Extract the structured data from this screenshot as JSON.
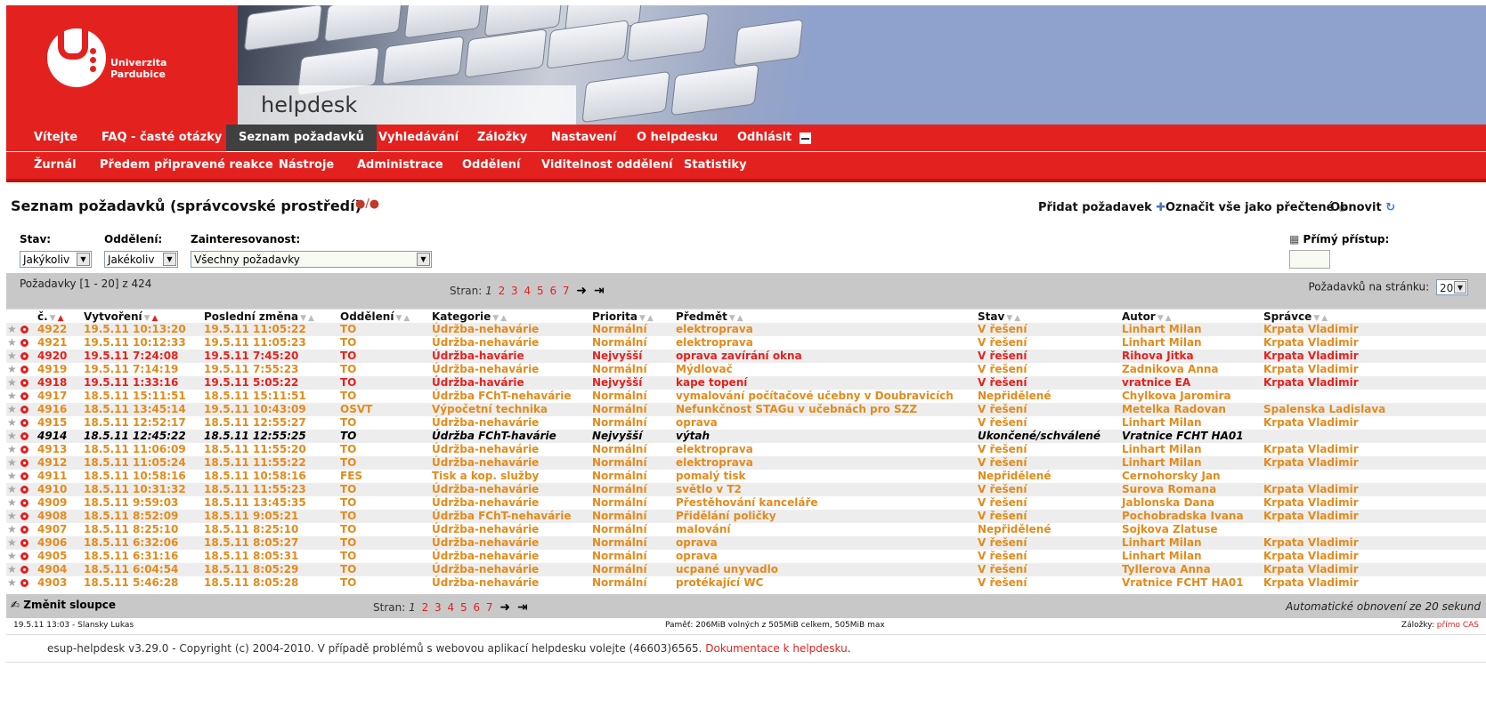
{
  "header": {
    "logo_text_1": "Univerzita",
    "logo_text_2": "Pardubice",
    "app_title": "helpdesk"
  },
  "nav_primary": [
    {
      "label": "Vítejte",
      "active": false
    },
    {
      "label": "FAQ - časté otázky",
      "active": false
    },
    {
      "label": "Seznam požadavků",
      "active": true
    },
    {
      "label": "Vyhledávání",
      "active": false
    },
    {
      "label": "Záložky",
      "active": false
    },
    {
      "label": "Nastavení",
      "active": false
    },
    {
      "label": "O helpdesku",
      "active": false
    },
    {
      "label": "Odhlásit",
      "active": false
    }
  ],
  "nav_secondary": [
    {
      "label": "Žurnál"
    },
    {
      "label": "Předem připravené reakce"
    },
    {
      "label": "Nástroje"
    },
    {
      "label": "Administrace"
    },
    {
      "label": "Oddělení"
    },
    {
      "label": "Viditelnost oddělení"
    },
    {
      "label": "Statistiky"
    }
  ],
  "page": {
    "title": "Seznam požadavků (správcovské prostředí)",
    "add_label": "Přidat požadavek",
    "mark_read_label": "Označit vše jako přečtené",
    "refresh_label": "Obnovit"
  },
  "filters": {
    "state_label": "Stav:",
    "state_value": "Jakýkoliv",
    "dept_label": "Oddělení:",
    "dept_value": "Jakékoliv",
    "interest_label": "Zainteresovanost:",
    "interest_value": "Všechny požadavky",
    "direct_label": "Přímý přístup:",
    "direct_value": ""
  },
  "paging": {
    "summary": "Požadavky [1 - 20] z 424",
    "label": "Stran:",
    "current": "1",
    "pages": [
      "2",
      "3",
      "4",
      "5",
      "6",
      "7"
    ],
    "per_page_label": "Požadavků na stránku:",
    "per_page_value": "20"
  },
  "columns": [
    "č.",
    "Vytvoření",
    "Poslední změna",
    "Oddělení",
    "Kategorie",
    "Priorita",
    "Předmět",
    "Stav",
    "Autor",
    "Správce"
  ],
  "tickets": [
    {
      "id": "4922",
      "created": "19.5.11 10:13:20",
      "changed": "19.5.11 11:05:22",
      "dept": "TO",
      "category": "Údržba-nehavárie",
      "priority": "Normální",
      "subject": "elektroprava",
      "status": "V řešení",
      "author": "Linhart Milan",
      "manager": "Krpata Vladimir",
      "tone": "orange"
    },
    {
      "id": "4921",
      "created": "19.5.11 10:12:33",
      "changed": "19.5.11 11:05:23",
      "dept": "TO",
      "category": "Údržba-nehavárie",
      "priority": "Normální",
      "subject": "elektroprava",
      "status": "V řešení",
      "author": "Linhart Milan",
      "manager": "Krpata Vladimir",
      "tone": "orange"
    },
    {
      "id": "4920",
      "created": "19.5.11 7:24:08",
      "changed": "19.5.11 7:45:20",
      "dept": "TO",
      "category": "Údržba-havárie",
      "priority": "Nejvyšší",
      "subject": "oprava zavírání okna",
      "status": "V řešení",
      "author": "Rihova Jitka",
      "manager": "Krpata Vladimir",
      "tone": "red"
    },
    {
      "id": "4919",
      "created": "19.5.11 7:14:19",
      "changed": "19.5.11 7:55:23",
      "dept": "TO",
      "category": "Údržba-nehavárie",
      "priority": "Normální",
      "subject": "Mýdlovač",
      "status": "V řešení",
      "author": "Zadnikova Anna",
      "manager": "Krpata Vladimir",
      "tone": "orange"
    },
    {
      "id": "4918",
      "created": "19.5.11 1:33:16",
      "changed": "19.5.11 5:05:22",
      "dept": "TO",
      "category": "Údržba-havárie",
      "priority": "Nejvyšší",
      "subject": "kape topení",
      "status": "V řešení",
      "author": "vratnice EA",
      "manager": "Krpata Vladimir",
      "tone": "red"
    },
    {
      "id": "4917",
      "created": "18.5.11 15:11:51",
      "changed": "18.5.11 15:11:51",
      "dept": "TO",
      "category": "Údržba FChT-nehavárie",
      "priority": "Normální",
      "subject": "vymalování počítačové učebny v Doubravicích",
      "status": "Nepřidělené",
      "author": "Chylkova Jaromira",
      "manager": "",
      "tone": "orange"
    },
    {
      "id": "4916",
      "created": "18.5.11 13:45:14",
      "changed": "19.5.11 10:43:09",
      "dept": "OSVT",
      "category": "Výpočetní technika",
      "priority": "Normální",
      "subject": "Nefunkčnost STAGu v učebnách pro SZZ",
      "status": "V řešení",
      "author": "Metelka Radovan",
      "manager": "Spalenska Ladislava",
      "tone": "orange"
    },
    {
      "id": "4915",
      "created": "18.5.11 12:52:17",
      "changed": "18.5.11 12:55:27",
      "dept": "TO",
      "category": "Údržba-nehavárie",
      "priority": "Normální",
      "subject": "oprava",
      "status": "V řešení",
      "author": "Linhart Milan",
      "manager": "Krpata Vladimir",
      "tone": "orange"
    },
    {
      "id": "4914",
      "created": "18.5.11 12:45:22",
      "changed": "18.5.11 12:55:25",
      "dept": "TO",
      "category": "Údržba FChT-havárie",
      "priority": "Nejvyšší",
      "subject": "výtah",
      "status": "Ukončené/schválené",
      "author": "Vratnice FCHT HA01",
      "manager": "",
      "tone": "black"
    },
    {
      "id": "4913",
      "created": "18.5.11 11:06:09",
      "changed": "18.5.11 11:55:20",
      "dept": "TO",
      "category": "Údržba-nehavárie",
      "priority": "Normální",
      "subject": "elektroprava",
      "status": "V řešení",
      "author": "Linhart Milan",
      "manager": "Krpata Vladimir",
      "tone": "orange"
    },
    {
      "id": "4912",
      "created": "18.5.11 11:05:24",
      "changed": "18.5.11 11:55:22",
      "dept": "TO",
      "category": "Údržba-nehavárie",
      "priority": "Normální",
      "subject": "elektroprava",
      "status": "V řešení",
      "author": "Linhart Milan",
      "manager": "Krpata Vladimir",
      "tone": "orange"
    },
    {
      "id": "4911",
      "created": "18.5.11 10:58:16",
      "changed": "18.5.11 10:58:16",
      "dept": "FES",
      "category": "Tisk a kop. služby",
      "priority": "Normální",
      "subject": "pomalý tisk",
      "status": "Nepřidělené",
      "author": "Cernohorsky Jan",
      "manager": "",
      "tone": "orange"
    },
    {
      "id": "4910",
      "created": "18.5.11 10:31:32",
      "changed": "18.5.11 11:55:23",
      "dept": "TO",
      "category": "Údržba-nehavárie",
      "priority": "Normální",
      "subject": "světlo v T2",
      "status": "V řešení",
      "author": "Surova Romana",
      "manager": "Krpata Vladimir",
      "tone": "orange"
    },
    {
      "id": "4909",
      "created": "18.5.11 9:59:03",
      "changed": "18.5.11 13:45:35",
      "dept": "TO",
      "category": "Údržba-nehavárie",
      "priority": "Normální",
      "subject": "Přestěhování kanceláře",
      "status": "V řešení",
      "author": "Jablonska Dana",
      "manager": "Krpata Vladimir",
      "tone": "orange"
    },
    {
      "id": "4908",
      "created": "18.5.11 8:52:09",
      "changed": "18.5.11 9:05:21",
      "dept": "TO",
      "category": "Údržba FChT-nehavárie",
      "priority": "Normální",
      "subject": "Přidělání poličky",
      "status": "V řešení",
      "author": "Pochobradska Ivana",
      "manager": "Krpata Vladimir",
      "tone": "orange"
    },
    {
      "id": "4907",
      "created": "18.5.11 8:25:10",
      "changed": "18.5.11 8:25:10",
      "dept": "TO",
      "category": "Údržba-nehavárie",
      "priority": "Normální",
      "subject": "malování",
      "status": "Nepřidělené",
      "author": "Sojkova Zlatuse",
      "manager": "",
      "tone": "orange"
    },
    {
      "id": "4906",
      "created": "18.5.11 6:32:06",
      "changed": "18.5.11 8:05:27",
      "dept": "TO",
      "category": "Údržba-nehavárie",
      "priority": "Normální",
      "subject": "oprava",
      "status": "V řešení",
      "author": "Linhart Milan",
      "manager": "Krpata Vladimir",
      "tone": "orange"
    },
    {
      "id": "4905",
      "created": "18.5.11 6:31:16",
      "changed": "18.5.11 8:05:31",
      "dept": "TO",
      "category": "Údržba-nehavárie",
      "priority": "Normální",
      "subject": "oprava",
      "status": "V řešení",
      "author": "Linhart Milan",
      "manager": "Krpata Vladimir",
      "tone": "orange"
    },
    {
      "id": "4904",
      "created": "18.5.11 6:04:54",
      "changed": "18.5.11 8:05:29",
      "dept": "TO",
      "category": "Údržba-nehavárie",
      "priority": "Normální",
      "subject": "ucpané unyvadlo",
      "status": "V řešení",
      "author": "Tyllerova Anna",
      "manager": "Krpata Vladimir",
      "tone": "orange"
    },
    {
      "id": "4903",
      "created": "18.5.11 5:46:28",
      "changed": "18.5.11 8:05:28",
      "dept": "TO",
      "category": "Údržba-nehavárie",
      "priority": "Normální",
      "subject": "protékající WC",
      "status": "V řešení",
      "author": "Vratnice FCHT HA01",
      "manager": "Krpata Vladimir",
      "tone": "orange"
    }
  ],
  "bottom": {
    "change_columns": "Změnit sloupce",
    "auto_refresh": "Automatické obnovení ze 20 sekund"
  },
  "statusbar": {
    "left": "19.5.11 13:03 - Slansky Lukas",
    "center": "Paměť: 206MiB volných z 505MiB celkem, 505MiB max",
    "right_label": "Záložky:",
    "right_link": "přímo CAS"
  },
  "footer": {
    "text": "esup-helpdesk v3.29.0 - Copyright (c) 2004-2010. V případě problémů s webovou aplikací helpdesku volejte (46603)6565.",
    "link": "Dokumentace k helpdesku",
    "tail": "."
  },
  "colors": {
    "brand_red": "#e3221f",
    "row_orange": "#e38b1c",
    "header_blue": "#8fa2cd"
  }
}
